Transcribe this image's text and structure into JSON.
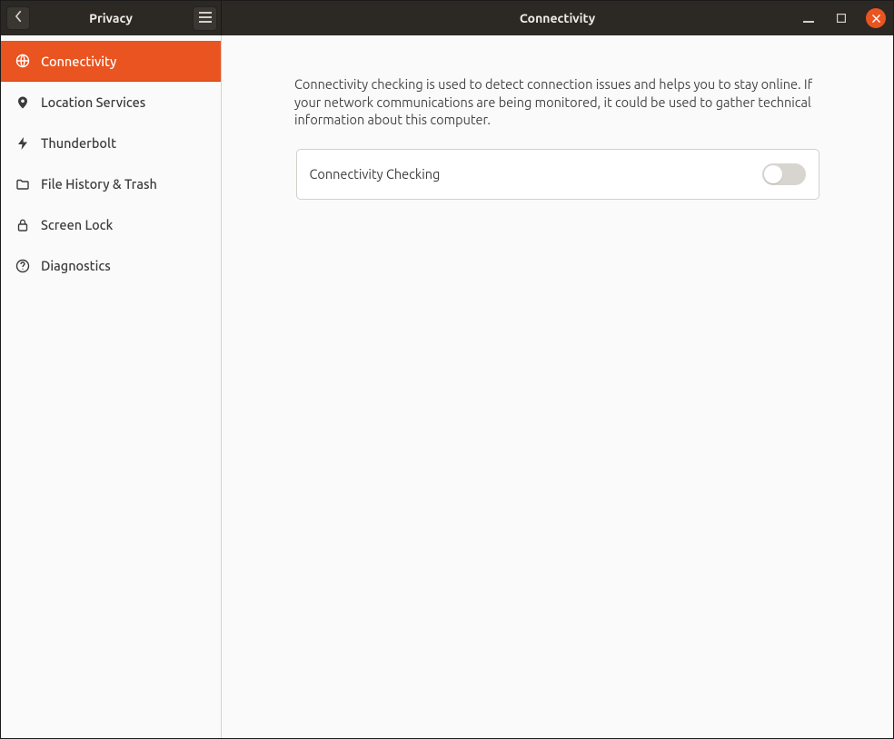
{
  "header": {
    "left_title": "Privacy",
    "right_title": "Connectivity"
  },
  "sidebar": {
    "items": [
      {
        "label": "Connectivity",
        "icon": "globe-icon",
        "active": true
      },
      {
        "label": "Location Services",
        "icon": "location-icon",
        "active": false
      },
      {
        "label": "Thunderbolt",
        "icon": "thunderbolt-icon",
        "active": false
      },
      {
        "label": "File History & Trash",
        "icon": "folder-icon",
        "active": false
      },
      {
        "label": "Screen Lock",
        "icon": "lock-icon",
        "active": false
      },
      {
        "label": "Diagnostics",
        "icon": "help-icon",
        "active": false
      }
    ]
  },
  "main": {
    "description": "Connectivity checking is used to detect connection issues and helps you to stay online. If your network communications are being monitored, it could be used to gather technical information about this computer.",
    "setting_label": "Connectivity Checking",
    "toggle_state": "off"
  },
  "colors": {
    "accent": "#e95420"
  }
}
